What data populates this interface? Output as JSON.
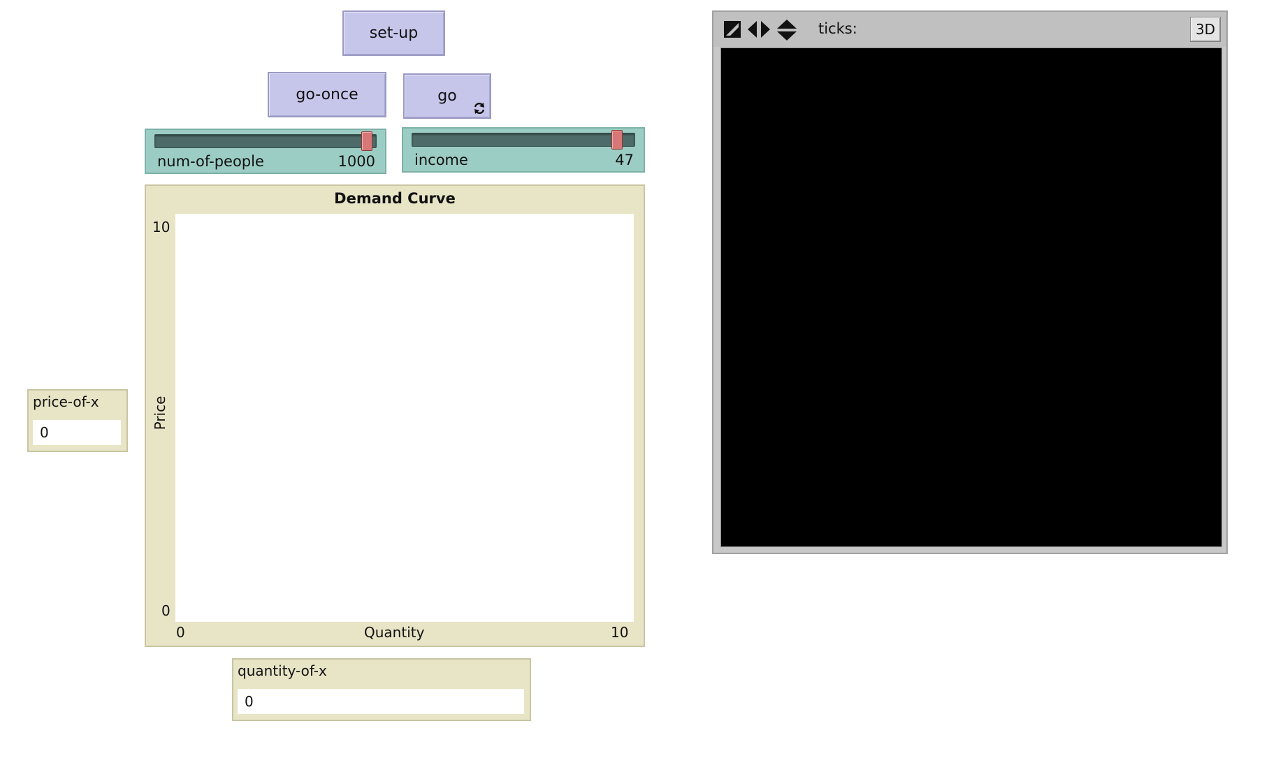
{
  "buttons": {
    "setup": "set-up",
    "go_once": "go-once",
    "go": "go",
    "go_forever_icon": "forever-loop-icon"
  },
  "sliders": {
    "num_of_people": {
      "label": "num-of-people",
      "value": "1000",
      "fraction": 0.98
    },
    "income": {
      "label": "income",
      "value": "47",
      "fraction": 0.94
    }
  },
  "plot": {
    "title": "Demand Curve",
    "chart_data": {
      "type": "line",
      "title": "Demand Curve",
      "xlabel": "Quantity",
      "ylabel": "Price",
      "xlim": [
        0,
        10
      ],
      "ylim": [
        0,
        10
      ],
      "x_tick_labels": [
        "0",
        "10"
      ],
      "y_tick_labels": [
        "10",
        "0"
      ],
      "series": []
    }
  },
  "monitors": {
    "price_of_x": {
      "label": "price-of-x",
      "value": "0"
    },
    "quantity_of_x": {
      "label": "quantity-of-x",
      "value": "0"
    }
  },
  "world": {
    "ticks_label": "ticks:",
    "ticks_value": "",
    "three_d_label": "3D",
    "background": "#000000"
  },
  "colors": {
    "button": "#c6c6ea",
    "slider": "#9ccdc4",
    "slider_thumb": "#d77777",
    "plot_bg": "#e8e5c6",
    "monitor_bg": "#e8e5c6",
    "toolbar": "#c0c0c0"
  }
}
